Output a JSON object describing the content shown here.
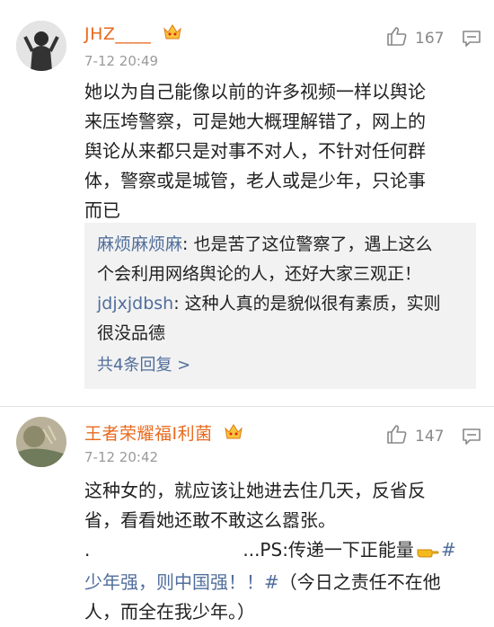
{
  "comments": [
    {
      "username": "JHZ____",
      "time": "7-12 20:49",
      "likes": "167",
      "badge_icon": "vip-crown-icon",
      "content_lines": [
        "她以为自己能像以前的许多视频一样以舆论",
        "来压垮警察，可是她大概理解错了，网上的",
        "舆论从来都只是对事不对人，不针对任何群",
        "体，警察或是城管，老人或是少年，只论事",
        "而已"
      ],
      "replies": [
        {
          "author": "麻烦麻烦麻",
          "line1_text": ": 也是苦了这位警察了，遇上这么",
          "line2": "个会利用网络舆论的人，还好大家三观正！"
        },
        {
          "author": "jdjxjdbsh",
          "line1_text": ": 这种人真的是貌似很有素质，实则",
          "line2": "很没品德"
        }
      ],
      "more_replies": "共4条回复 >"
    },
    {
      "username": "王者荣耀福I利菌",
      "time": "7-12 20:42",
      "likes": "147",
      "badge_icon": "vip-crown-icon",
      "content_lines": [
        "这种女的，就应该让她进去住几天，反省反",
        "省，看看她还敢不敢这么嚣张。"
      ],
      "ps_prefix": ".",
      "ps_text": "...PS:传递一下正能量",
      "ps_hash": "#",
      "ps_line2_blue": "少年强，则中国强！！#",
      "ps_line2_rest": "（今日之责任不在他",
      "ps_line3": "人，而全在我少年。）"
    }
  ]
}
